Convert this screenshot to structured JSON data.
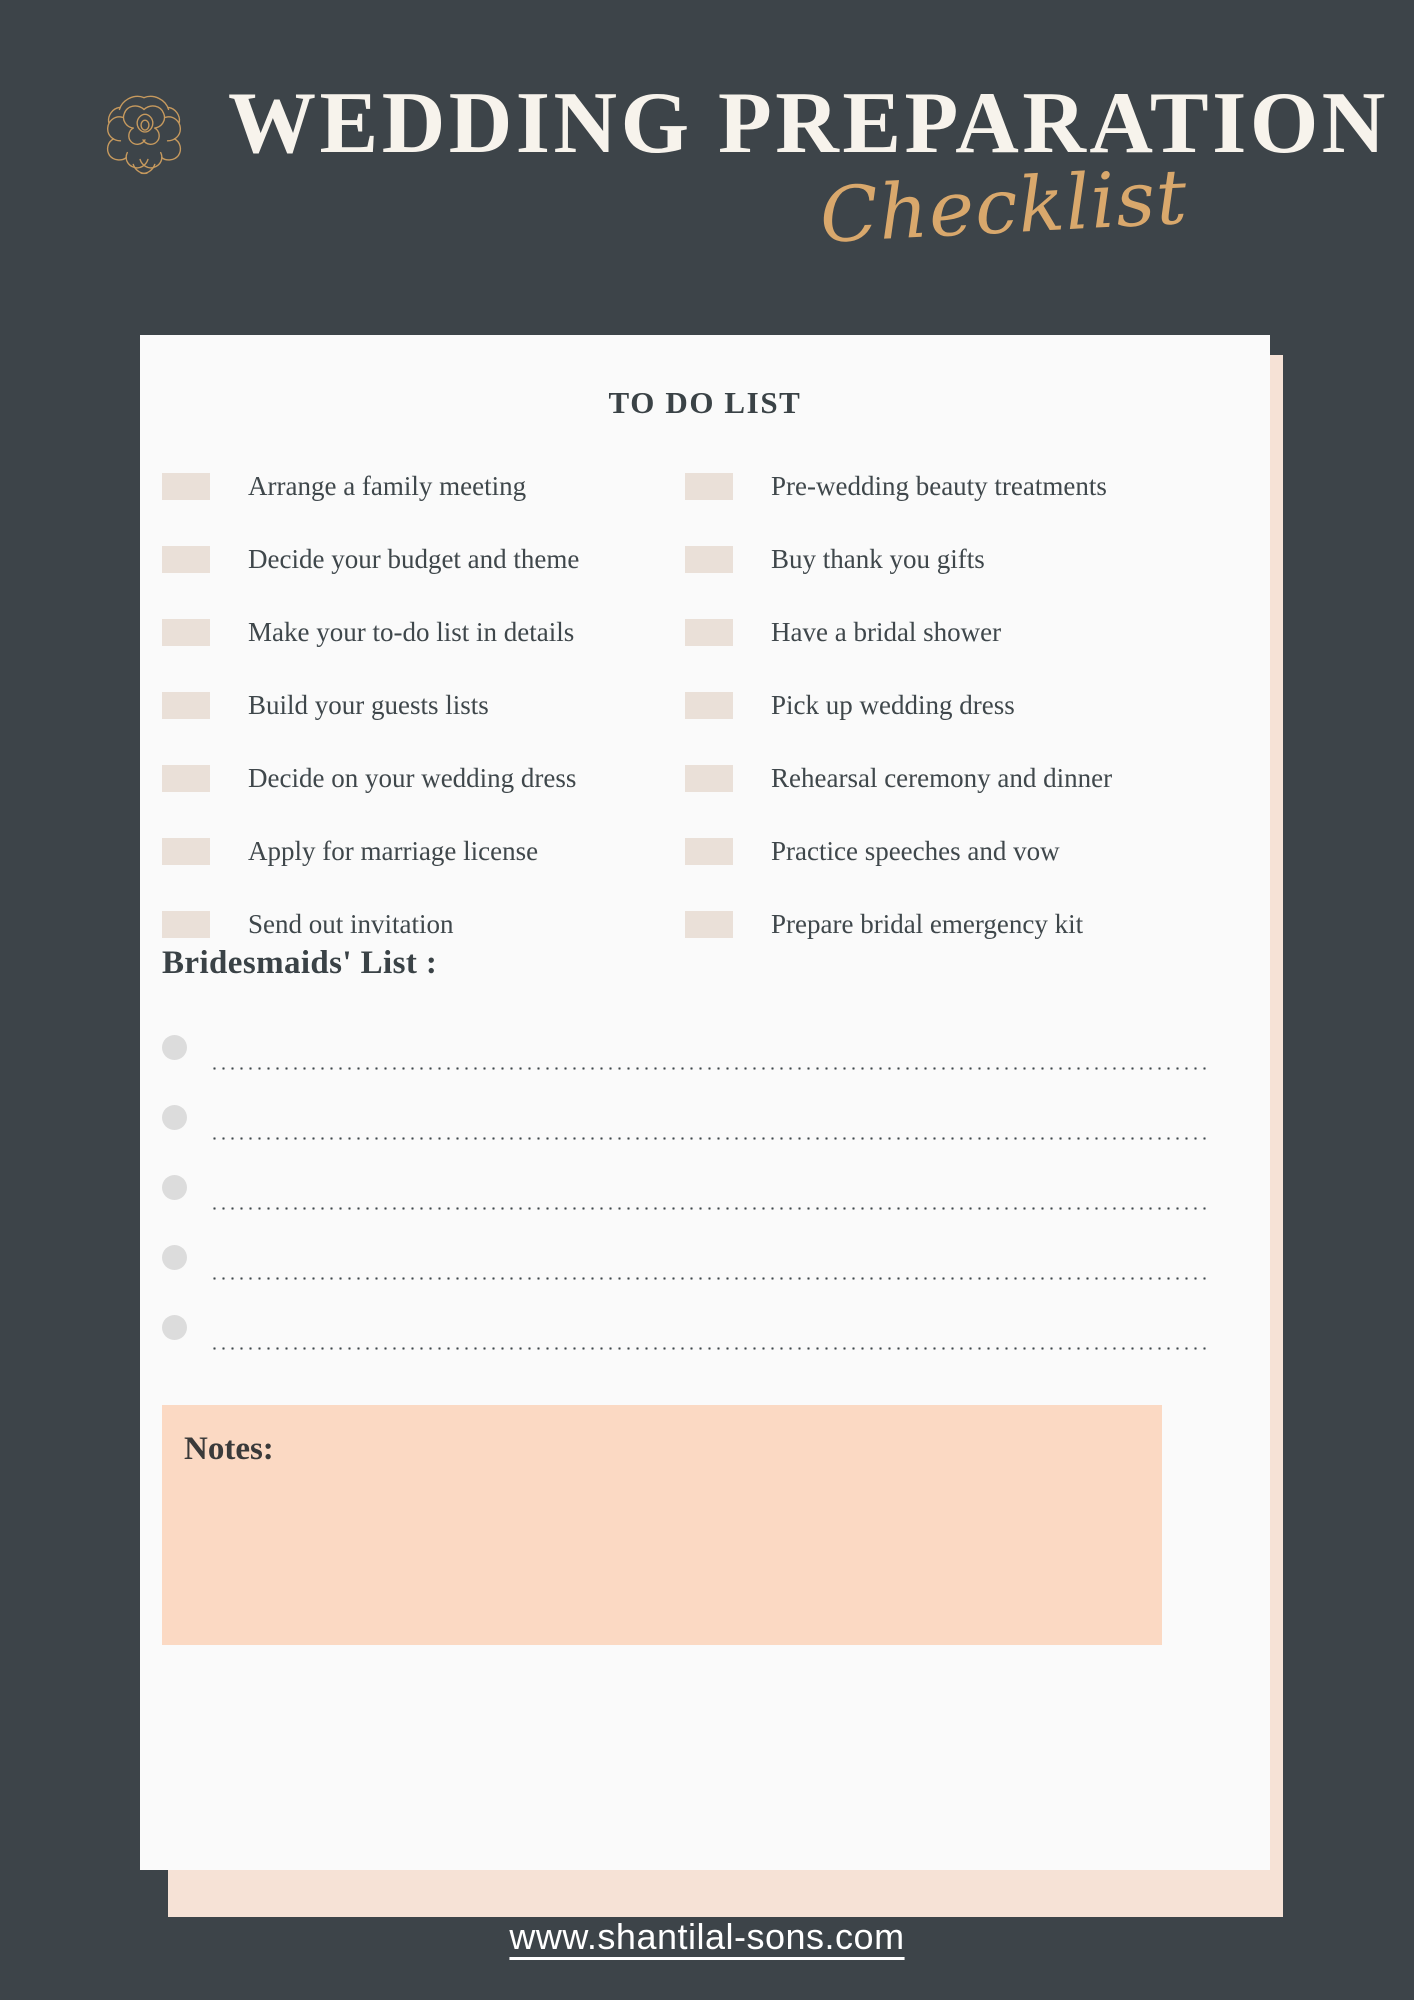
{
  "header": {
    "title_main": "WEDDING PREPARATION",
    "title_script": "Checklist",
    "rose_icon": "rose-flower-icon"
  },
  "card": {
    "todo_heading": "TO DO LIST",
    "todo_left": [
      "Arrange a family meeting",
      "Decide your budget and theme",
      "Make your to-do list in details",
      "Build your guests lists",
      "Decide on your wedding dress",
      "Apply for marriage license",
      "Send out invitation"
    ],
    "todo_right": [
      "Pre-wedding beauty treatments",
      "Buy thank you gifts",
      "Have a bridal shower",
      "Pick up wedding dress",
      "Rehearsal ceremony and dinner",
      "Practice speeches and vow",
      "Prepare bridal emergency kit"
    ],
    "bridesmaids_heading": "Bridesmaids' List :",
    "bridesmaids_rows": 5,
    "notes_label": "Notes:"
  },
  "footer": {
    "url": "www.shantilal-sons.com"
  },
  "colors": {
    "page_background": "#3d4449",
    "card_background": "#fafafa",
    "card_shadow": "#f6e2d6",
    "checkbox": "#eae0d8",
    "notes_background": "#fbd9c3",
    "gold_accent": "#d9a86c",
    "title_text": "#f7f3ec",
    "body_text": "#3f474b"
  }
}
